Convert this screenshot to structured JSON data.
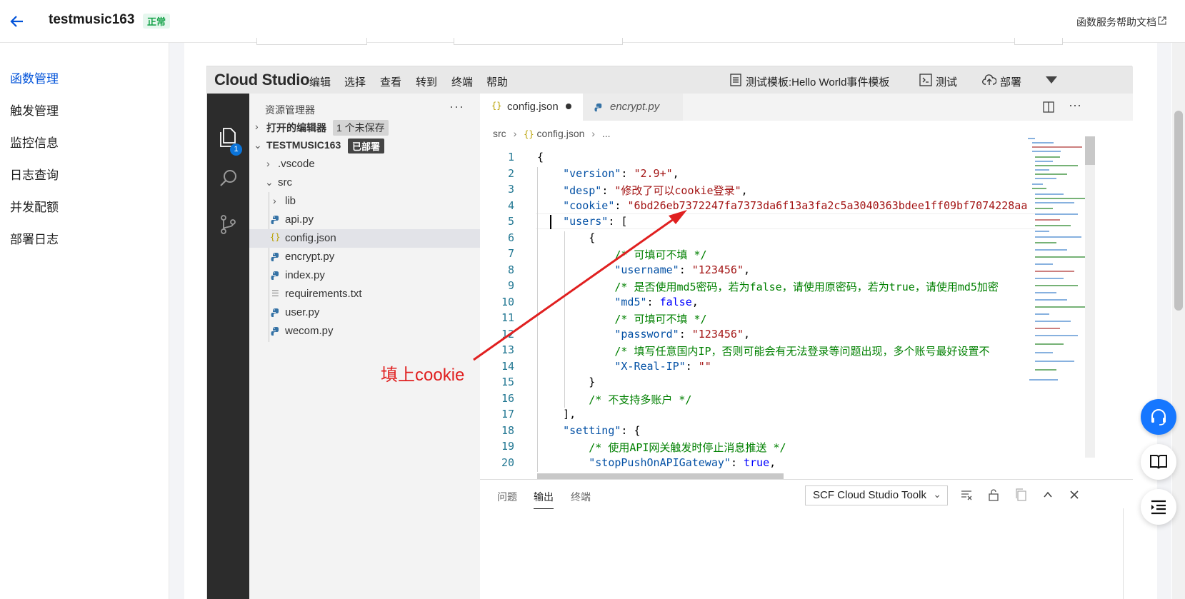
{
  "header": {
    "app_title": "testmusic163",
    "status_badge": "正常",
    "help_link": "函数服务帮助文档"
  },
  "sidebar": {
    "items": [
      {
        "label": "函数管理",
        "active": true
      },
      {
        "label": "触发管理"
      },
      {
        "label": "监控信息"
      },
      {
        "label": "日志查询"
      },
      {
        "label": "并发配额"
      },
      {
        "label": "部署日志"
      }
    ]
  },
  "cloud_studio": {
    "logo": "Cloud Studio",
    "menu": [
      "编辑",
      "选择",
      "查看",
      "转到",
      "终端",
      "帮助"
    ],
    "test_template": "测试模板:Hello World事件模板",
    "test_button": "测试",
    "deploy_button": "部署",
    "activity_badge": "1"
  },
  "explorer": {
    "title": "资源管理器",
    "open_editors": "打开的编辑器",
    "unsaved_tag": "1 个未保存",
    "project": "TESTMUSIC163",
    "deployed_tag": "已部署",
    "tree": [
      {
        "name": ".vscode",
        "type": "folder",
        "depth": 1
      },
      {
        "name": "src",
        "type": "folder-open",
        "depth": 1
      },
      {
        "name": "lib",
        "type": "folder",
        "depth": 2
      },
      {
        "name": "api.py",
        "type": "py",
        "depth": 2
      },
      {
        "name": "config.json",
        "type": "json",
        "depth": 2,
        "selected": true
      },
      {
        "name": "encrypt.py",
        "type": "py",
        "depth": 2
      },
      {
        "name": "index.py",
        "type": "py",
        "depth": 2
      },
      {
        "name": "requirements.txt",
        "type": "txt",
        "depth": 2
      },
      {
        "name": "user.py",
        "type": "py",
        "depth": 2
      },
      {
        "name": "wecom.py",
        "type": "py",
        "depth": 2
      }
    ]
  },
  "editor": {
    "tabs": [
      {
        "label": "config.json",
        "dirty": true,
        "active": true
      },
      {
        "label": "encrypt.py",
        "active": false
      }
    ],
    "breadcrumb": [
      "src",
      "config.json",
      "..."
    ],
    "lines": [
      "{",
      "    \"version\": \"2.9+\",",
      "    \"desp\": \"修改了可以cookie登录\",",
      "    \"cookie\": \"6bd26eb7372247fa7373da6f13a3fa2c5a3040363bdee1ff09bf7074228aa",
      "    \"users\": [",
      "        {",
      "            /* 可填可不填 */",
      "            \"username\": \"123456\",",
      "            /* 是否使用md5密码，若为false，请使用原密码，若为true，请使用md5加密",
      "            \"md5\": false,",
      "            /* 可填可不填 */",
      "            \"password\": \"123456\",",
      "            /* 填写任意国内IP，否则可能会有无法登录等问题出现，多个账号最好设置不",
      "            \"X-Real-IP\": \"\"",
      "        }",
      "        /* 不支持多账户 */",
      "    ],",
      "    \"setting\": {",
      "        /* 使用API网关触发时停止消息推送 */",
      "        \"stopPushOnAPIGateway\": true,"
    ]
  },
  "bottom_panel": {
    "tabs": [
      "问题",
      "输出",
      "终端"
    ],
    "active_tab": "输出",
    "output_select": "SCF Cloud Studio Toolk"
  },
  "annotation": {
    "text": "填上cookie",
    "color": "#e02020"
  },
  "colors": {
    "accent": "#0052d9",
    "status_green": "#16a34a",
    "fab_blue": "#1677ff"
  }
}
